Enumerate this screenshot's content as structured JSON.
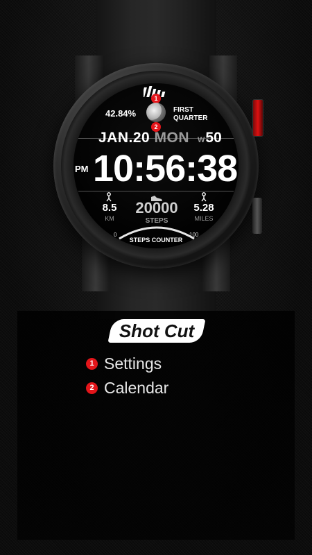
{
  "watch": {
    "moon_percent": "42.84%",
    "moon_phase_line1": "FIRST",
    "moon_phase_line2": "QUARTER",
    "date": "JAN.20",
    "day_of_week": "MON",
    "week_prefix": "W",
    "week_number": "50",
    "ampm": "PM",
    "time": "10:56:38",
    "distance_km": "8.5",
    "distance_km_unit": "KM",
    "steps": "20000",
    "steps_unit": "STEPS",
    "distance_miles": "5.28",
    "distance_miles_unit": "MILES",
    "gauge_min": "0",
    "gauge_max": "100",
    "gauge_title": "STEPS COUNTER",
    "step_progress": 1.0,
    "markers": [
      "1",
      "2"
    ],
    "icons": [
      "brand-bars-icon",
      "moon-icon",
      "walk-icon",
      "shoe-icon",
      "run-icon"
    ]
  },
  "panel": {
    "title": "Shot Cut",
    "items": [
      {
        "number": "1",
        "label": "Settings"
      },
      {
        "number": "2",
        "label": "Calendar"
      }
    ]
  },
  "colors": {
    "accent": "#e3151a",
    "text": "#ffffff",
    "muted": "#9a9a9a"
  }
}
